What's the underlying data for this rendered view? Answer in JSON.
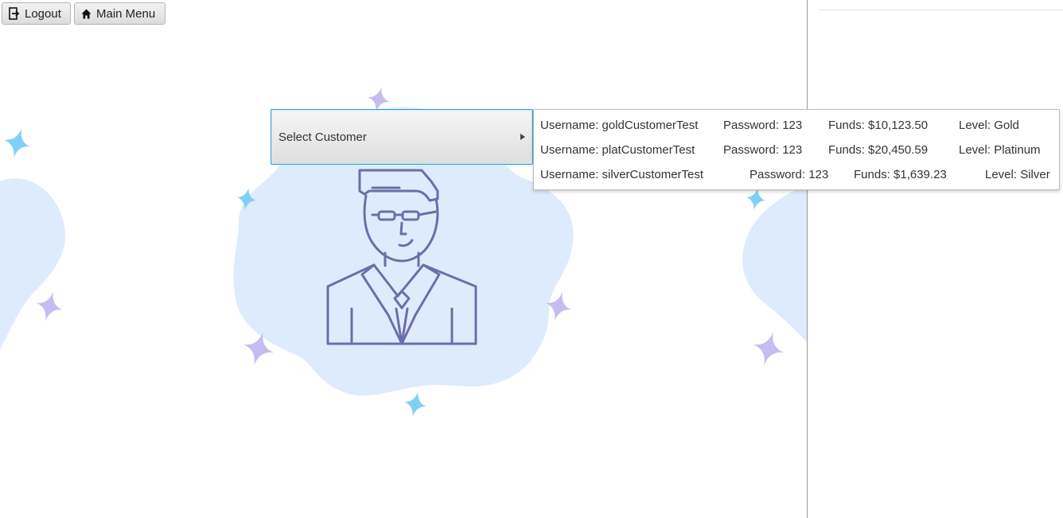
{
  "toolbar": {
    "logout_label": "Logout",
    "main_menu_label": "Main Menu"
  },
  "select_customer": {
    "label": "Select Customer"
  },
  "customers": [
    {
      "username": "Username: goldCustomerTest",
      "password": "Password: 123",
      "funds": "Funds: $10,123.50",
      "level": "Level: Gold"
    },
    {
      "username": "Username: platCustomerTest",
      "password": "Password: 123",
      "funds": "Funds: $20,450.59",
      "level": "Level: Platinum"
    },
    {
      "username": "Username: silverCustomerTest",
      "password": "Password: 123",
      "funds": "Funds: $1,639.23",
      "level": "Level: Silver"
    }
  ],
  "icons": {
    "logout": "logout-icon",
    "home": "home-icon",
    "submenu": "submenu-arrow-icon",
    "illustration": "customer-avatar-illustration"
  },
  "colors": {
    "accent_border": "#2fa1d8",
    "blob": "#deebfd",
    "figure_stroke": "#6b6ea8",
    "sparkle_blue": "#7fd0f5",
    "sparkle_purple": "#c5bdf2"
  }
}
